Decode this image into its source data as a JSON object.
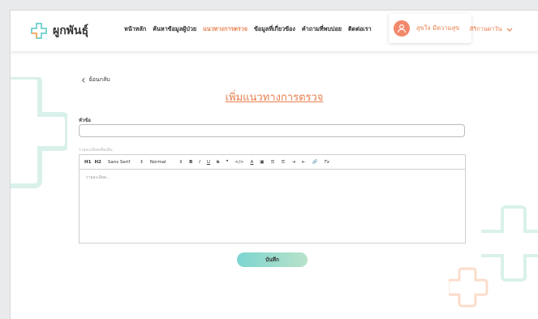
{
  "brand": {
    "name": "ผูกพันธุ์"
  },
  "nav": {
    "items": [
      {
        "label": "หน้าหลัก",
        "active": false
      },
      {
        "label": "ค้นหาข้อมูลผู้ป่วย",
        "active": false
      },
      {
        "label": "แนวทางการตรวจ",
        "active": true
      },
      {
        "label": "ข้อมูลที่เกี่ยวข้อง",
        "active": false
      },
      {
        "label": "คำถามที่พบบ่อย",
        "active": false
      },
      {
        "label": "ติดต่อเรา",
        "active": false
      }
    ]
  },
  "user": {
    "name": "สุขใจ มีความสุข"
  },
  "lang": {
    "label": "ศิริกานดาวัน"
  },
  "page": {
    "back_label": "ย้อนกลับ",
    "title": "เพิ่มแนวทางการตรวจ",
    "topic_label": "หัวข้อ",
    "topic_value": "",
    "detail_label": "รายละเอียดเพิ่มเติม",
    "editor_placeholder": "รายละเอียด...",
    "save_label": "บันทึก"
  },
  "toolbar": {
    "h1": "H1",
    "h2": "H2",
    "font": "Sans Serif",
    "size": "Normal",
    "bold": "B",
    "italic": "I",
    "underline": "U",
    "strike": "S",
    "quote": "❞",
    "code": "</>",
    "color": "A",
    "clean": "Tx"
  },
  "colors": {
    "accent": "#e9804f",
    "teal": "#7cd5d0",
    "avatar": "#f3886b"
  }
}
